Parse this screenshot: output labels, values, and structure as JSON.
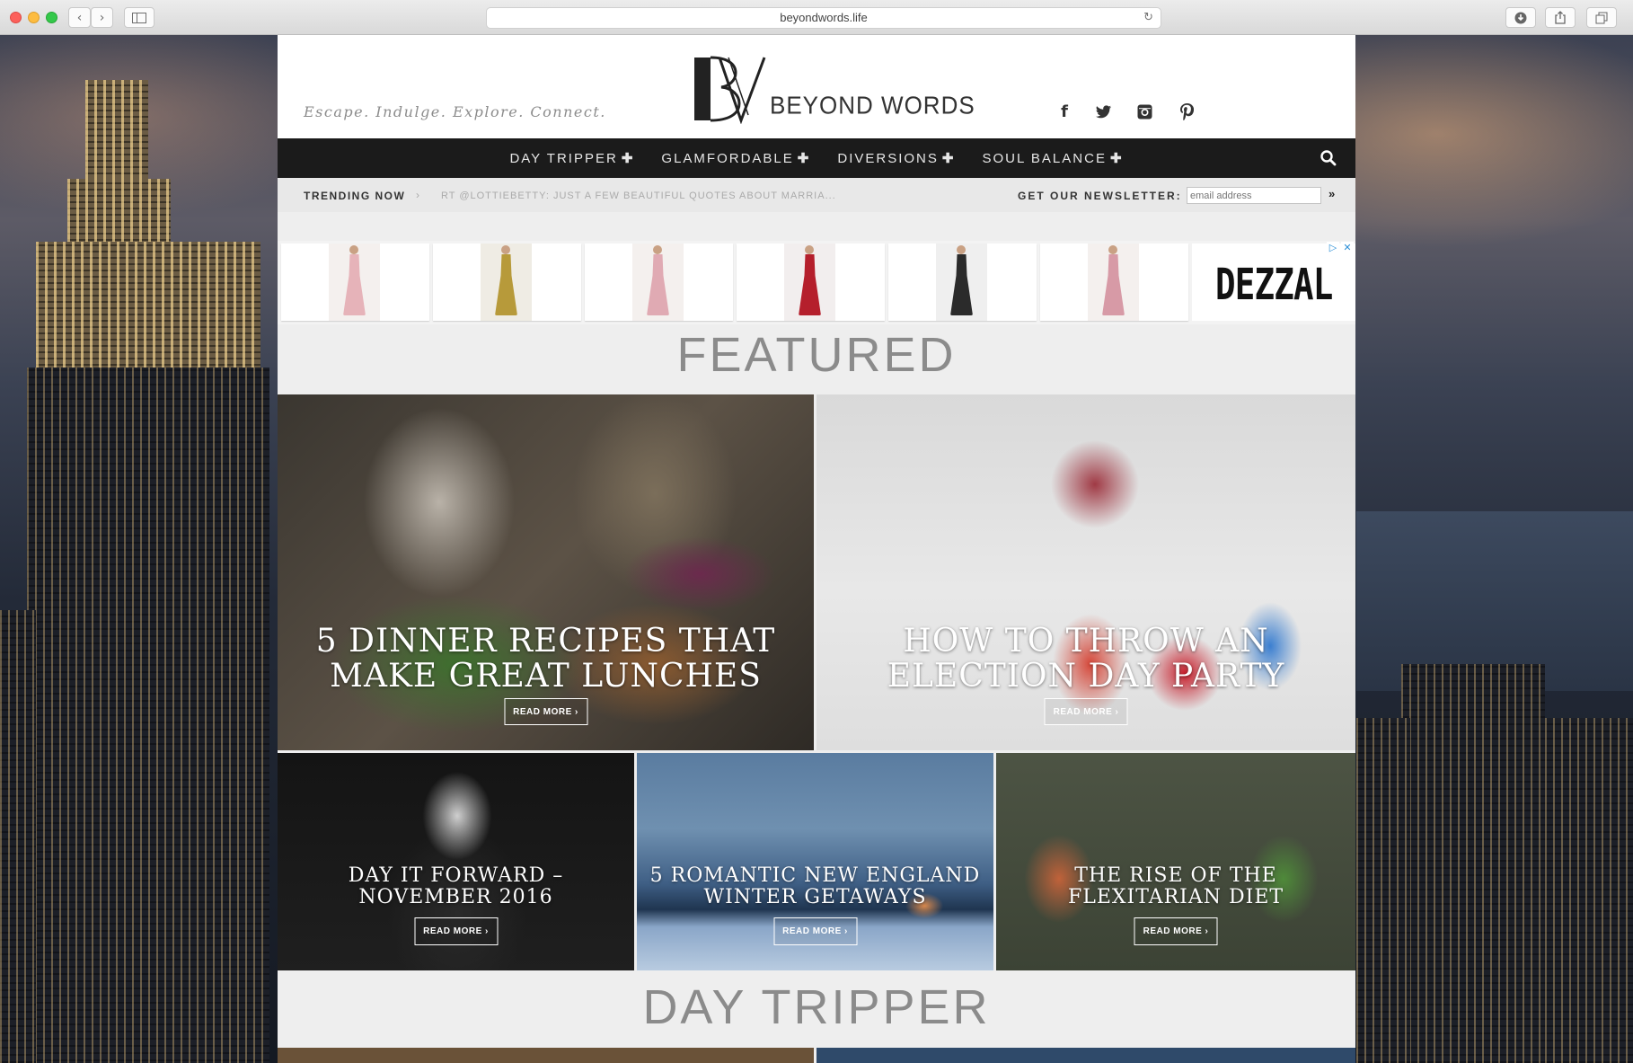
{
  "browser": {
    "url": "beyondwords.life"
  },
  "site": {
    "tagline": "Escape. Indulge. Explore. Connect.",
    "logo_text": "BEYOND WORDS",
    "social": [
      {
        "name": "facebook-icon",
        "glyph": "f"
      },
      {
        "name": "twitter-icon",
        "glyph": "🐦"
      },
      {
        "name": "instagram-icon",
        "glyph": "◙"
      },
      {
        "name": "pinterest-icon",
        "glyph": "℘"
      }
    ]
  },
  "nav": {
    "items": [
      {
        "label": "DAY TRIPPER",
        "plus": "✚"
      },
      {
        "label": "GLAMFORDABLE",
        "plus": "✚"
      },
      {
        "label": "DIVERSIONS",
        "plus": "✚"
      },
      {
        "label": "SOUL BALANCE",
        "plus": "✚"
      }
    ],
    "search_icon": "search-icon"
  },
  "trending": {
    "label": "TRENDING NOW",
    "arrow": "›",
    "text": "RT @LOTTIEBETTY: JUST A FEW BEAUTIFUL QUOTES ABOUT MARRIA..."
  },
  "newsletter": {
    "label": "GET OUR NEWSLETTER:",
    "placeholder": "email address",
    "submit": "»"
  },
  "ad": {
    "brand": "DEZZAL",
    "icons": [
      "▷",
      "✕"
    ],
    "dress_colors": [
      "#e6b3b9",
      "#b79a3a",
      "#e0aab3",
      "#b51f2c",
      "#2b2b2b",
      "#d79aa6"
    ]
  },
  "featured": {
    "heading": "FEATURED",
    "big": [
      {
        "title_line1": "5 DINNER RECIPES THAT",
        "title_line2": "MAKE GREAT LUNCHES",
        "button": "READ MORE ›"
      },
      {
        "title_line1": "HOW TO THROW AN",
        "title_line2": "ELECTION DAY PARTY",
        "button": "READ MORE ›"
      }
    ],
    "small": [
      {
        "title_line1": "DAY IT FORWARD –",
        "title_line2": "NOVEMBER 2016",
        "button": "READ MORE ›"
      },
      {
        "title_line1": "5 ROMANTIC NEW ENGLAND",
        "title_line2": "WINTER GETAWAYS",
        "button": "READ MORE ›"
      },
      {
        "title_line1": "THE RISE OF THE",
        "title_line2": "FLEXITARIAN DIET",
        "button": "READ MORE ›"
      }
    ]
  },
  "next_section": {
    "heading": "DAY TRIPPER"
  }
}
